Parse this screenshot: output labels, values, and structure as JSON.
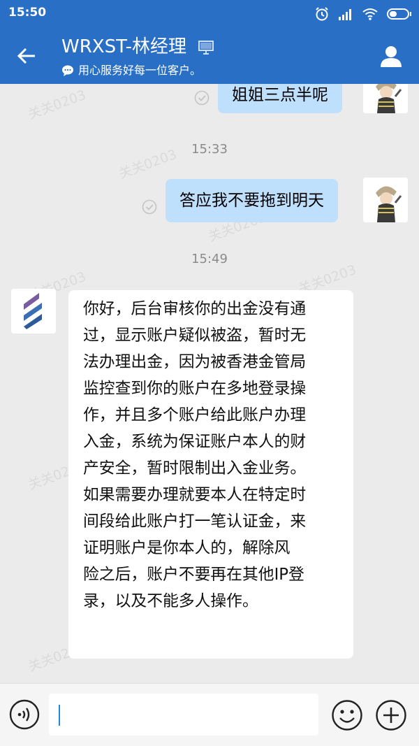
{
  "status_bar": {
    "time": "15:50",
    "icons": [
      "alarm-icon",
      "signal-icon",
      "wifi-icon",
      "battery-icon"
    ]
  },
  "header": {
    "contact_name": "WRXST-林经理",
    "status_text": "用心服务好每一位客户。",
    "icons": [
      "back-arrow-icon",
      "computer-icon",
      "chat-bubble-icon",
      "person-icon"
    ]
  },
  "watermark": "关关0203",
  "messages": [
    {
      "type": "out",
      "text": "姐姐三点半呢"
    },
    {
      "type": "time",
      "text": "15:33"
    },
    {
      "type": "out",
      "text": "答应我不要拖到明天"
    },
    {
      "type": "time",
      "text": "15:49"
    },
    {
      "type": "in",
      "lines": [
        "你好，后台审核你的出金没有通",
        "过，显示账户疑似被盗，暂时无",
        "法办理出金，因为被香港金管局",
        "监控查到你的账户在多地登录操",
        "作，并且多个账户给此账户办理",
        "入金，系统为保证账户本人的财",
        "产安全，暂时限制出入金业务。",
        "如果需要办理就要本人在特定时",
        "间段给此账户打一笔认证金，来",
        "证明账户是你本人的，解除风",
        "险之后，账户不要再在其他IP登",
        "录，以及不能多人操作。"
      ]
    }
  ],
  "input_bar": {
    "message_value": "",
    "icons": [
      "voice-icon",
      "emoji-icon",
      "plus-icon"
    ]
  },
  "colors": {
    "header": "#2a6fc6",
    "outgoing_bubble": "#bfe0fc",
    "incoming_bubble": "#ffffff",
    "chat_background": "#ebebeb"
  }
}
